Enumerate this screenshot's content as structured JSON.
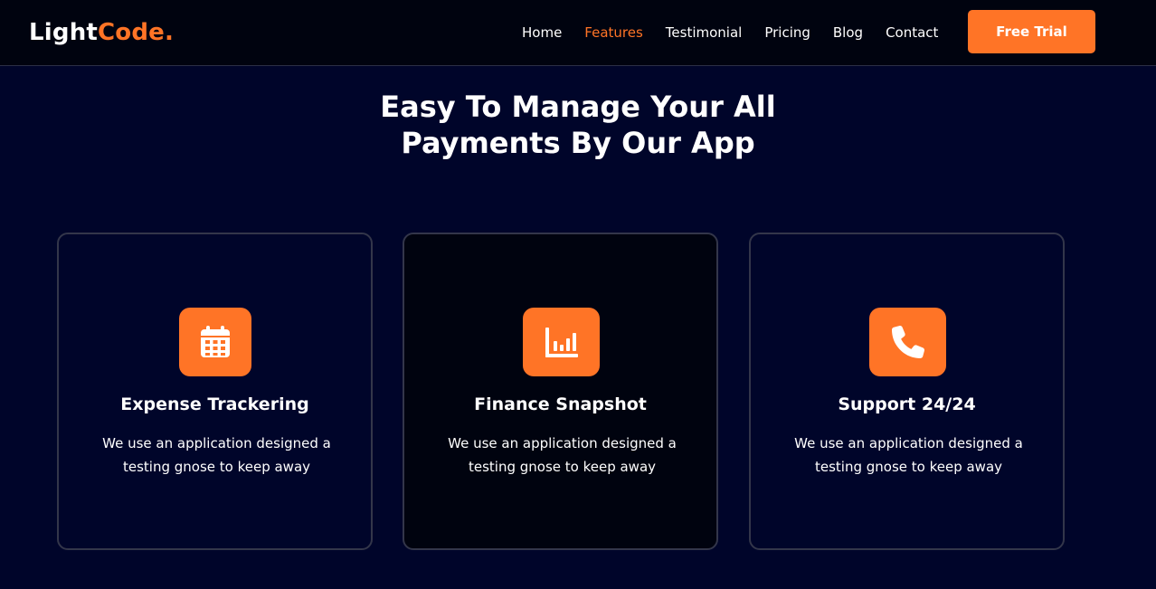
{
  "header": {
    "logo_part1": "Light",
    "logo_part2": "Code.",
    "nav": [
      "Home",
      "Features",
      "Testimonial",
      "Pricing",
      "Blog",
      "Contact"
    ],
    "active_nav": "Features",
    "cta_label": "Free Trial"
  },
  "section": {
    "title": "Easy To Manage Your All\nPayments By Our App"
  },
  "cards": [
    {
      "title": "Expense Trackering",
      "text": "We use an application designed a testing gnose to keep away",
      "icon": "calendar-icon"
    },
    {
      "title": "Finance Snapshot",
      "text": "We use an application designed a testing gnose to keep away",
      "icon": "bar-chart-icon"
    },
    {
      "title": "Support 24/24",
      "text": "We use an application designed a testing gnose to keep away",
      "icon": "phone-icon"
    }
  ],
  "colors": {
    "accent": "#ff7426",
    "background": "#00052a",
    "navbar_background": "#00030f"
  }
}
